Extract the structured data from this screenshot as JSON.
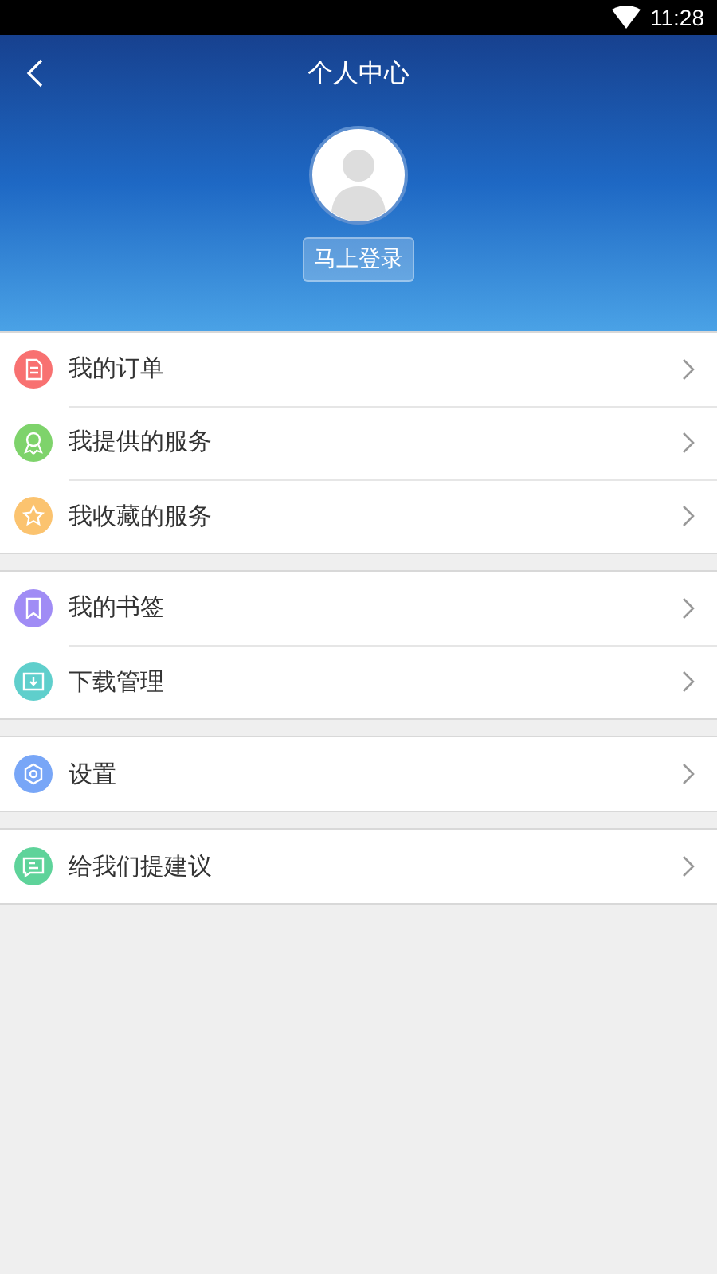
{
  "status_bar": {
    "time": "11:28"
  },
  "header": {
    "title": "个人中心",
    "login_button": "马上登录"
  },
  "groups": [
    {
      "items": [
        {
          "label": "我的订单",
          "kind": "document",
          "color": "#f87171"
        },
        {
          "label": "我提供的服务",
          "kind": "award",
          "color": "#7ed36b"
        },
        {
          "label": "我收藏的服务",
          "kind": "star",
          "color": "#fbc36f"
        }
      ]
    },
    {
      "items": [
        {
          "label": "我的书签",
          "kind": "bookmark",
          "color": "#a08cf5"
        },
        {
          "label": "下载管理",
          "kind": "download",
          "color": "#5fcfcc"
        }
      ]
    },
    {
      "items": [
        {
          "label": "设置",
          "kind": "gear",
          "color": "#78a6f7"
        }
      ]
    },
    {
      "items": [
        {
          "label": "给我们提建议",
          "kind": "message",
          "color": "#5ed39a"
        }
      ]
    }
  ]
}
